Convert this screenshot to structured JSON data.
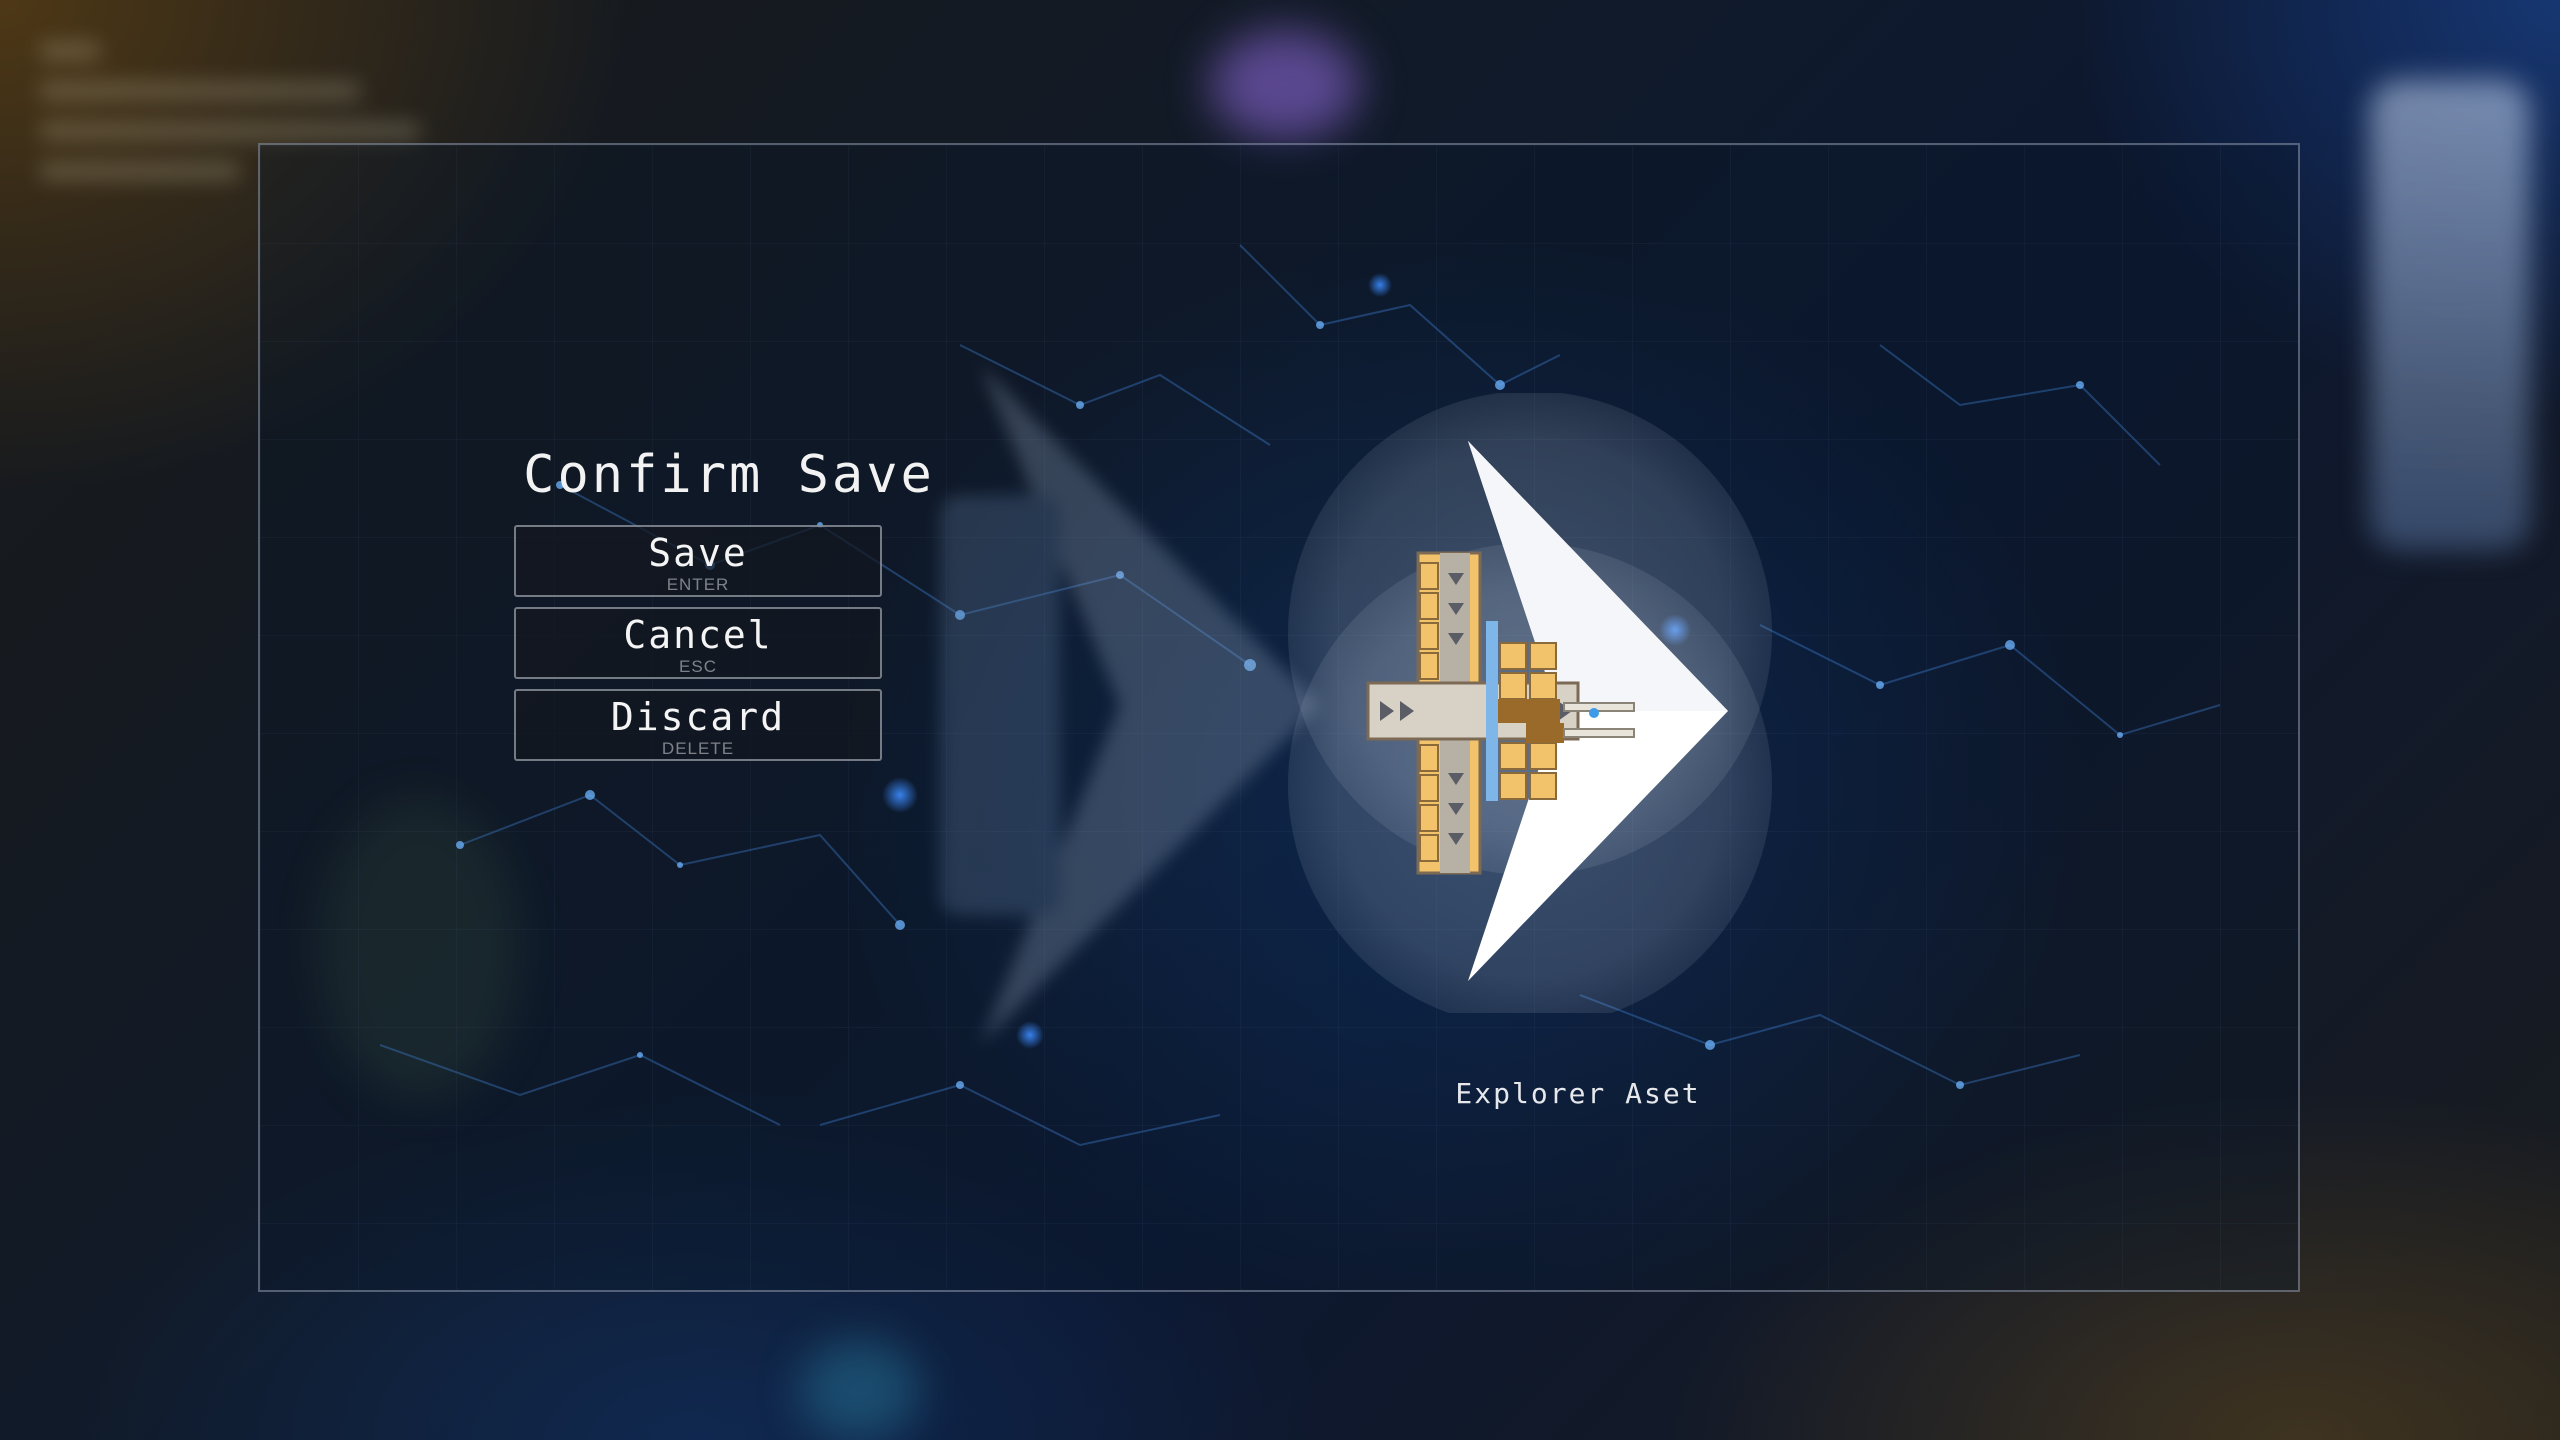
{
  "dialog": {
    "title": "Confirm Save",
    "actions": [
      {
        "label": "Save",
        "hotkey": "ENTER"
      },
      {
        "label": "Cancel",
        "hotkey": "ESC"
      },
      {
        "label": "Discard",
        "hotkey": "DELETE"
      }
    ]
  },
  "ship": {
    "name": "Explorer Aset",
    "icon": "spaceship-icon"
  },
  "colors": {
    "accent_hull": "#f2c36b",
    "hull_dark": "#9a6a2a",
    "wing": "#ffffff",
    "frame_border": "#aab4c8",
    "shield_bubble": "#dfe6f0"
  },
  "cursor": {
    "icon": "pointer-cursor-icon"
  }
}
